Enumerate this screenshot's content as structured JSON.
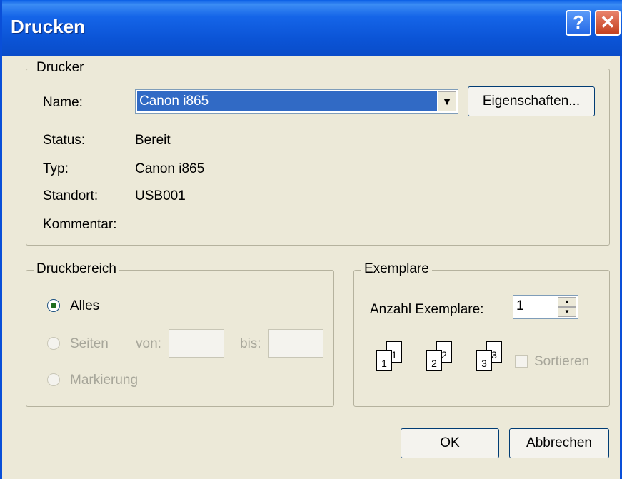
{
  "window": {
    "title": "Drucken",
    "help_glyph": "?",
    "close_glyph": "✕"
  },
  "printer": {
    "legend": "Drucker",
    "name_label": "Name:",
    "name_value": "Canon i865",
    "properties_button": "Eigenschaften...",
    "status_label": "Status:",
    "status_value": "Bereit",
    "type_label": "Typ:",
    "type_value": "Canon i865",
    "location_label": "Standort:",
    "location_value": "USB001",
    "comment_label": "Kommentar:"
  },
  "range": {
    "legend": "Druckbereich",
    "all_label": "Alles",
    "pages_label": "Seiten",
    "from_label": "von:",
    "to_label": "bis:",
    "selection_label": "Markierung",
    "selected": "all"
  },
  "copies": {
    "legend": "Exemplare",
    "count_label": "Anzahl Exemplare:",
    "count_value": "1",
    "collate_label": "Sortieren",
    "collate_checked": false,
    "page_digits": [
      "1",
      "1",
      "2",
      "2",
      "3",
      "3"
    ]
  },
  "buttons": {
    "ok": "OK",
    "cancel": "Abbrechen"
  },
  "icons": {
    "dropdown": "chevron-down-icon",
    "help": "help-icon",
    "close": "close-icon"
  }
}
